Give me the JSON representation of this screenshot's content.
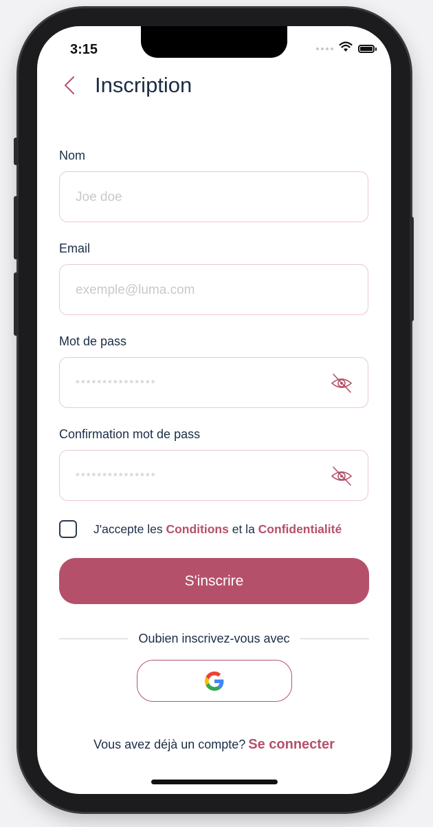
{
  "status_bar": {
    "time": "3:15"
  },
  "header": {
    "title": "Inscription",
    "back_icon": "chevron-left-icon"
  },
  "form": {
    "name": {
      "label": "Nom",
      "value": "",
      "placeholder": "Joe doe"
    },
    "email": {
      "label": "Email",
      "value": "",
      "placeholder": "exemple@luma.com"
    },
    "password": {
      "label": "Mot de pass",
      "value": "",
      "placeholder": "***************",
      "toggle_icon": "eye-off-icon"
    },
    "confirm_password": {
      "label": "Confirmation mot de pass",
      "value": "",
      "placeholder": "***************",
      "toggle_icon": "eye-off-icon"
    }
  },
  "terms": {
    "checked": false,
    "prefix": "J'accepte les ",
    "conditions_link": "Conditions",
    "middle": " et la ",
    "privacy_link": "Confidentialité"
  },
  "submit_label": "S'inscrire",
  "social": {
    "divider_text": "Oubien inscrivez-vous avec",
    "google_icon": "google-logo-icon"
  },
  "footer": {
    "question": "Vous avez déjà un compte?",
    "login_link": "Se connecter"
  },
  "colors": {
    "accent": "#b5506b",
    "text": "#1b2d45",
    "field_border": "#ecc7d1"
  }
}
